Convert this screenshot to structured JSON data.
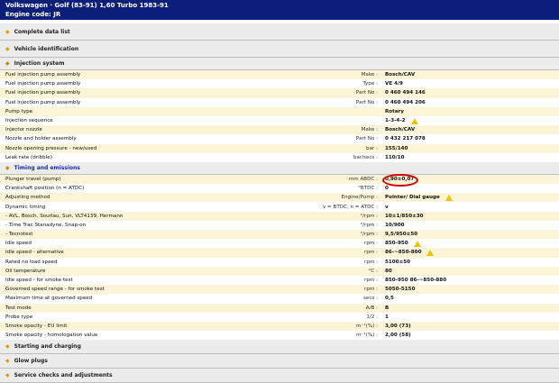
{
  "header": {
    "title": "Volkswagen · Golf (83-91) 1,60 Turbo 1983-91",
    "engine_code": "Engine code: JR"
  },
  "sections": {
    "complete_data_list": "Complete data list",
    "vehicle_identification": "Vehicle identification",
    "injection_system": "Injection system",
    "timing_and_emissions": "Timing and emissions",
    "starting_and_charging": "Starting and charging",
    "glow_plugs": "Glow plugs",
    "service_checks": "Service checks and adjustments"
  },
  "injection_rows": [
    {
      "label": "Fuel injection pump assembly",
      "unit": "Make :",
      "value": "Bosch/CAV"
    },
    {
      "label": "Fuel injection pump assembly",
      "unit": "Type :",
      "value": "VE 4/9"
    },
    {
      "label": "Fuel injection pump assembly",
      "unit": "Part No :",
      "value": "0 460 494 146"
    },
    {
      "label": "Fuel injection pump assembly",
      "unit": "Part No :",
      "value": "0 460 494 206"
    },
    {
      "label": "Pump type",
      "unit": "",
      "value": "Rotary"
    },
    {
      "label": "Injection sequence",
      "unit": "",
      "value": "1-3-4-2"
    },
    {
      "label": "Injector nozzle",
      "unit": "Make :",
      "value": "Bosch/CAV"
    },
    {
      "label": "Nozzle and holder assembly",
      "unit": "Part No :",
      "value": "0 432 217 078"
    },
    {
      "label": "Nozzle opening pressure - new/used",
      "unit": "bar :",
      "value": "155/140"
    },
    {
      "label": "Leak rate (dribble)",
      "unit": "bar/secs :",
      "value": "110/10"
    }
  ],
  "timing_rows": [
    {
      "label": "Plunger travel (pump)",
      "unit": "mm ABDC :",
      "value": "0,90±0,07"
    },
    {
      "label": "Crankshaft position (n = ATDC)",
      "unit": "°BTDC :",
      "value": "0"
    },
    {
      "label": "Adjusting method",
      "unit": "Engine/Pump :",
      "value": "Pointer/ Dial gauge"
    },
    {
      "label": "Dynamic timing",
      "unit": "v = BTDC, n = ATDC :",
      "value": "v"
    },
    {
      "label": "- AVL, Bosch, Sourlau, Sun, VLT4139, Hermann",
      "unit": "°/rpm :",
      "value": "10±1/850±30"
    },
    {
      "label": "- Time Trac Stanadyne, Snap-on",
      "unit": "°/rpm :",
      "value": "10/900"
    },
    {
      "label": "- Tecnotest",
      "unit": "°/rpm :",
      "value": "9,5/950±50"
    },
    {
      "label": "Idle speed",
      "unit": "rpm :",
      "value": "850-950"
    },
    {
      "label": "Idle speed - alternative",
      "unit": "rpm :",
      "value": "86-~850-800"
    },
    {
      "label": "Rated no load speed",
      "unit": "rpm :",
      "value": "5100±50"
    },
    {
      "label": "Oil temperature",
      "unit": "°C :",
      "value": "80"
    },
    {
      "label": "Idle speed - for smoke test",
      "unit": "rpm :",
      "value": "850-950 86-~850-880"
    },
    {
      "label": "Governed speed range - for smoke test",
      "unit": "rpm :",
      "value": "5050-5150"
    },
    {
      "label": "Maximum time at governed speed",
      "unit": "secs :",
      "value": "0,5"
    },
    {
      "label": "Test mode",
      "unit": "A/B :",
      "value": "B"
    },
    {
      "label": "Probe type",
      "unit": "1/2 :",
      "value": "1"
    },
    {
      "label": "Smoke opacity - EU limit",
      "unit": "m⁻¹(%) :",
      "value": "3,00 (73)"
    },
    {
      "label": "Smoke opacity - homologation value",
      "unit": "m⁻¹(%) :",
      "value": "2,00 (58)"
    }
  ],
  "icons": {
    "section_marker": "diamond-icon",
    "warning": "warning-triangle-icon",
    "highlight": "red-ellipse"
  },
  "colors": {
    "header_bg": "#0b1e7a",
    "row_alt": "#fbf4d6",
    "warning": "#f2c200",
    "highlight": "#d40000"
  }
}
